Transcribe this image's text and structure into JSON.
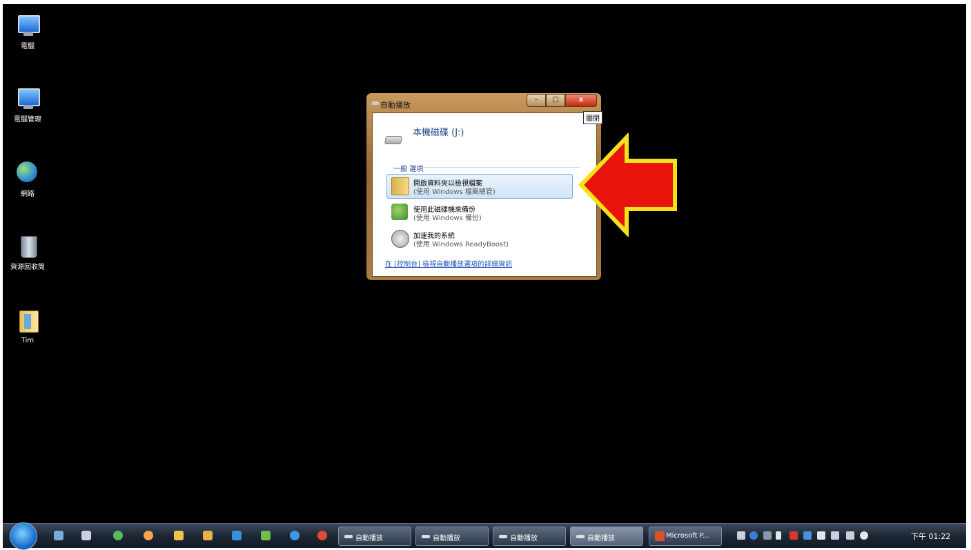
{
  "desktop": {
    "icons": [
      {
        "label": "電腦",
        "icon": "computer-icon"
      },
      {
        "label": "電腦管理",
        "icon": "computer-management-icon"
      },
      {
        "label": "網路",
        "icon": "network-icon"
      },
      {
        "label": "資源回收筒",
        "icon": "recycle-bin-icon"
      },
      {
        "label": "Tim",
        "icon": "user-folder-icon"
      }
    ]
  },
  "dialog": {
    "title": "自動播放",
    "close_label": "x",
    "tooltip": "關閉",
    "drive_title": "本機磁碟 (J:)",
    "section_label": "一般 選項",
    "options": [
      {
        "main": "開啟資料夾以檢視檔案",
        "sub": "(使用 Windows 檔案總管)",
        "icon": "folder-icon"
      },
      {
        "main": "使用此磁碟機來備份",
        "sub": "(使用 Windows 備份)",
        "icon": "backup-icon"
      },
      {
        "main": "加速我的系統",
        "sub": "(使用 Windows ReadyBoost)",
        "icon": "readyboost-icon"
      }
    ],
    "control_panel_link": "在 [控制台] 檢視自動播放選項的詳細資訊"
  },
  "annotation": {
    "color": "#e8140c",
    "outline": "#f6e21a"
  },
  "taskbar": {
    "buttons": [
      {
        "label": "自動播放"
      },
      {
        "label": "自動播放"
      },
      {
        "label": "自動播放"
      },
      {
        "label": "自動播放"
      },
      {
        "label": "Microsoft P..."
      }
    ],
    "clock": "下午 01:22"
  }
}
